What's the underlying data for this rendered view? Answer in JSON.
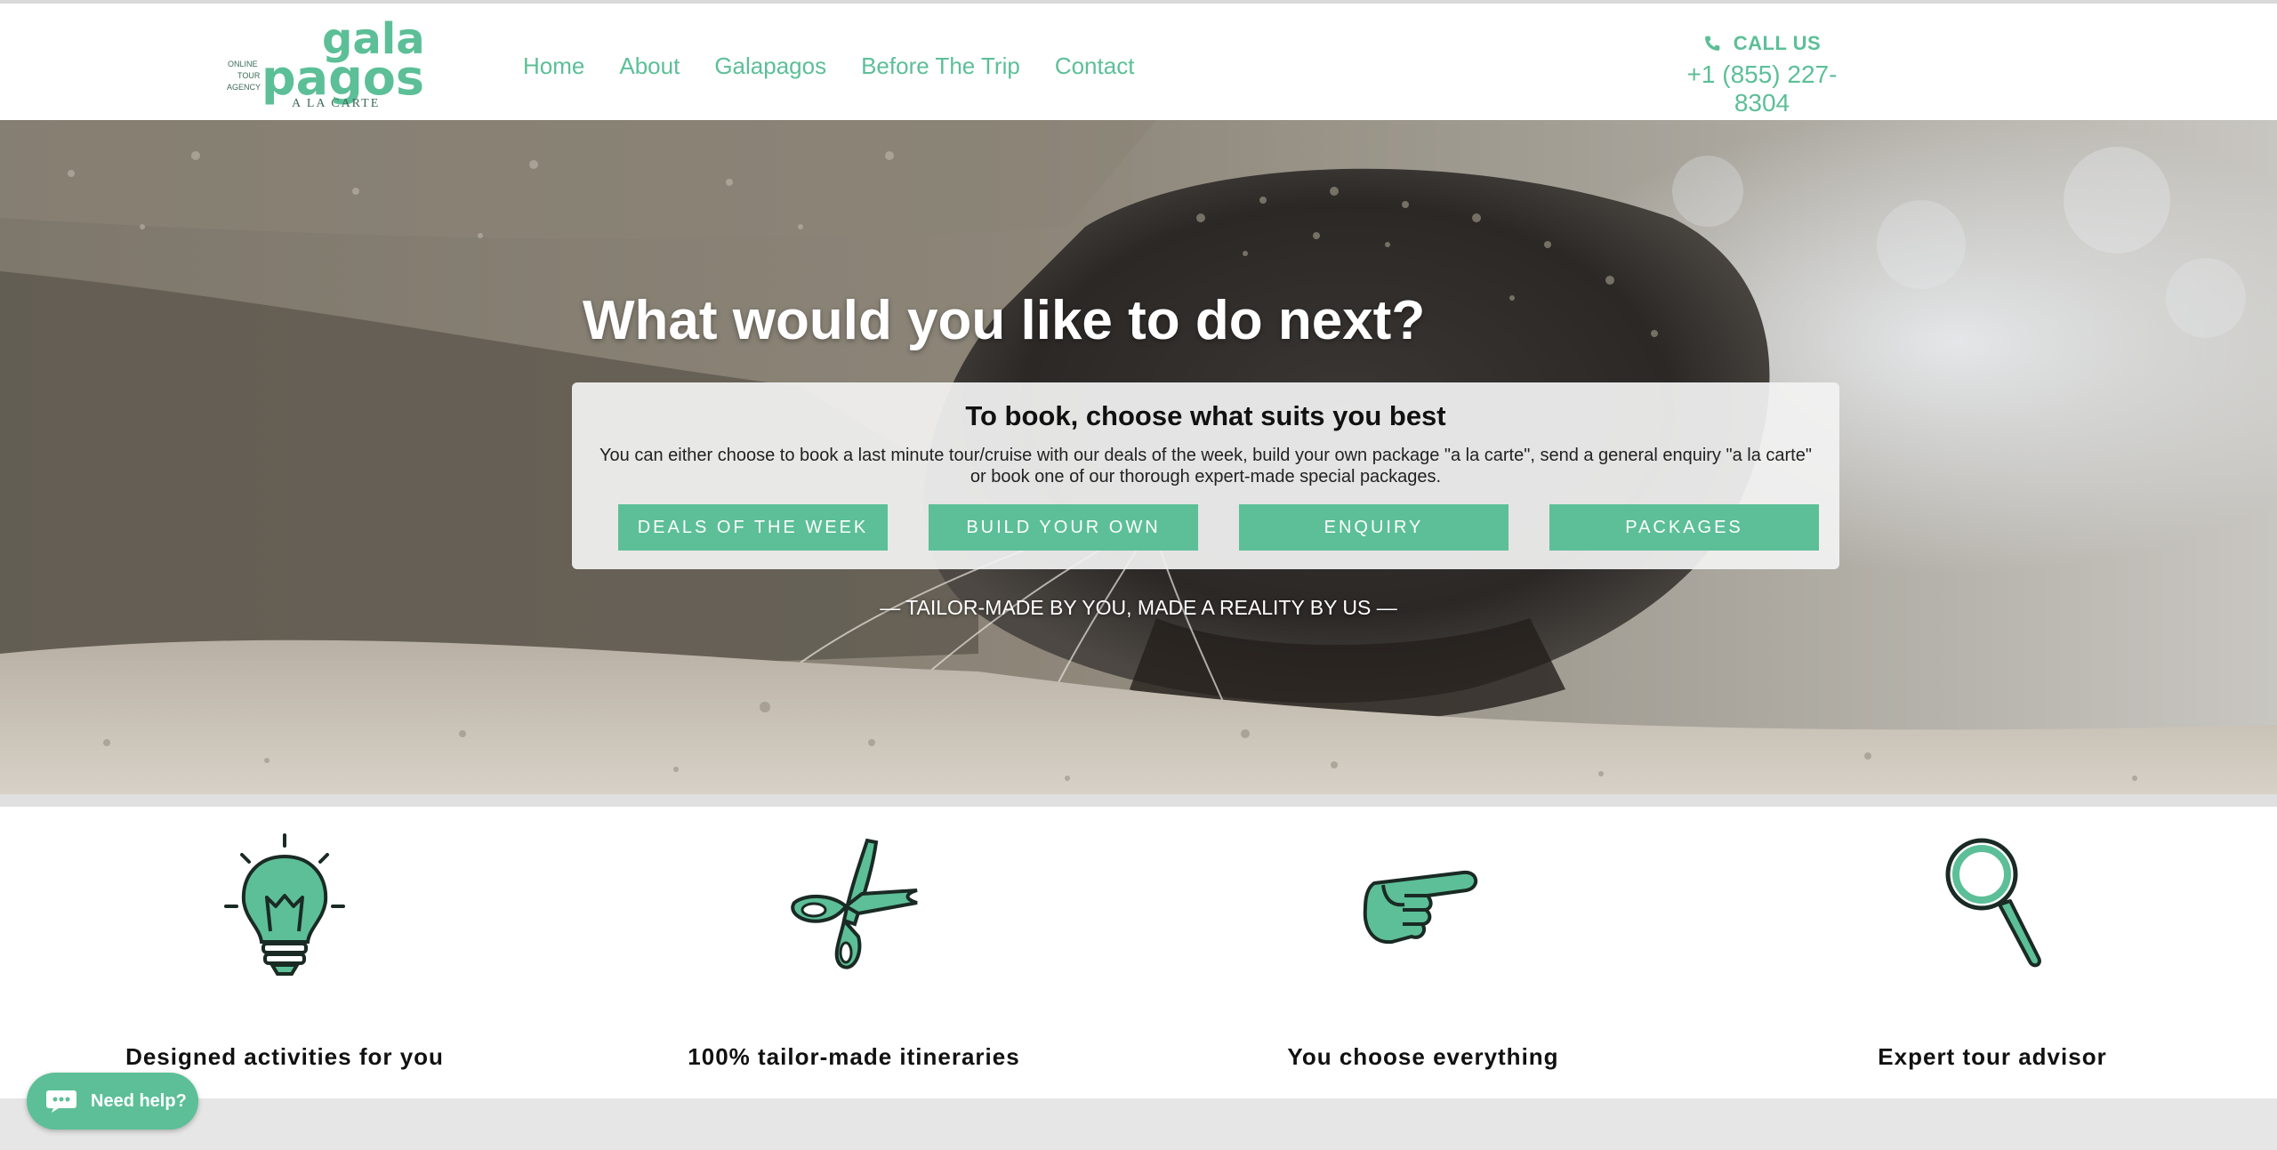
{
  "logo": {
    "small_lines": [
      "ONLINE",
      "TOUR",
      "AGENCY"
    ],
    "word_top": "gala",
    "word_bottom": "pagos",
    "tag": "A LA CARTE"
  },
  "nav": [
    {
      "label": "Home"
    },
    {
      "label": "About"
    },
    {
      "label": "Galapagos"
    },
    {
      "label": "Before The Trip"
    },
    {
      "label": "Contact"
    }
  ],
  "call": {
    "label": "CALL US",
    "phone": "+1 (855) 227-8304"
  },
  "hero": {
    "title": "What would you like to do next?",
    "box_title": "To book, choose what suits you best",
    "box_text": "You can either choose to book a last minute tour/cruise with our deals of the week, build your own package \"a la carte\", send a general enquiry \"a la carte\" or book one of our thorough expert-made special packages.",
    "buttons": [
      {
        "label": "DEALS OF THE WEEK"
      },
      {
        "label": "BUILD YOUR OWN"
      },
      {
        "label": "ENQUIRY"
      },
      {
        "label": "PACKAGES"
      }
    ],
    "tagline": "— TAILOR-MADE BY YOU, MADE A REALITY BY US —"
  },
  "features": [
    {
      "label": "Designed activities for you",
      "icon": "lightbulb-icon"
    },
    {
      "label": "100% tailor-made itineraries",
      "icon": "scissors-icon"
    },
    {
      "label": "You choose everything",
      "icon": "pointing-hand-icon"
    },
    {
      "label": "Expert tour advisor",
      "icon": "magnifier-icon"
    }
  ],
  "help": {
    "label": "Need help?"
  },
  "colors": {
    "accent": "#5cbf97",
    "dark_outline": "#1a2a24"
  }
}
